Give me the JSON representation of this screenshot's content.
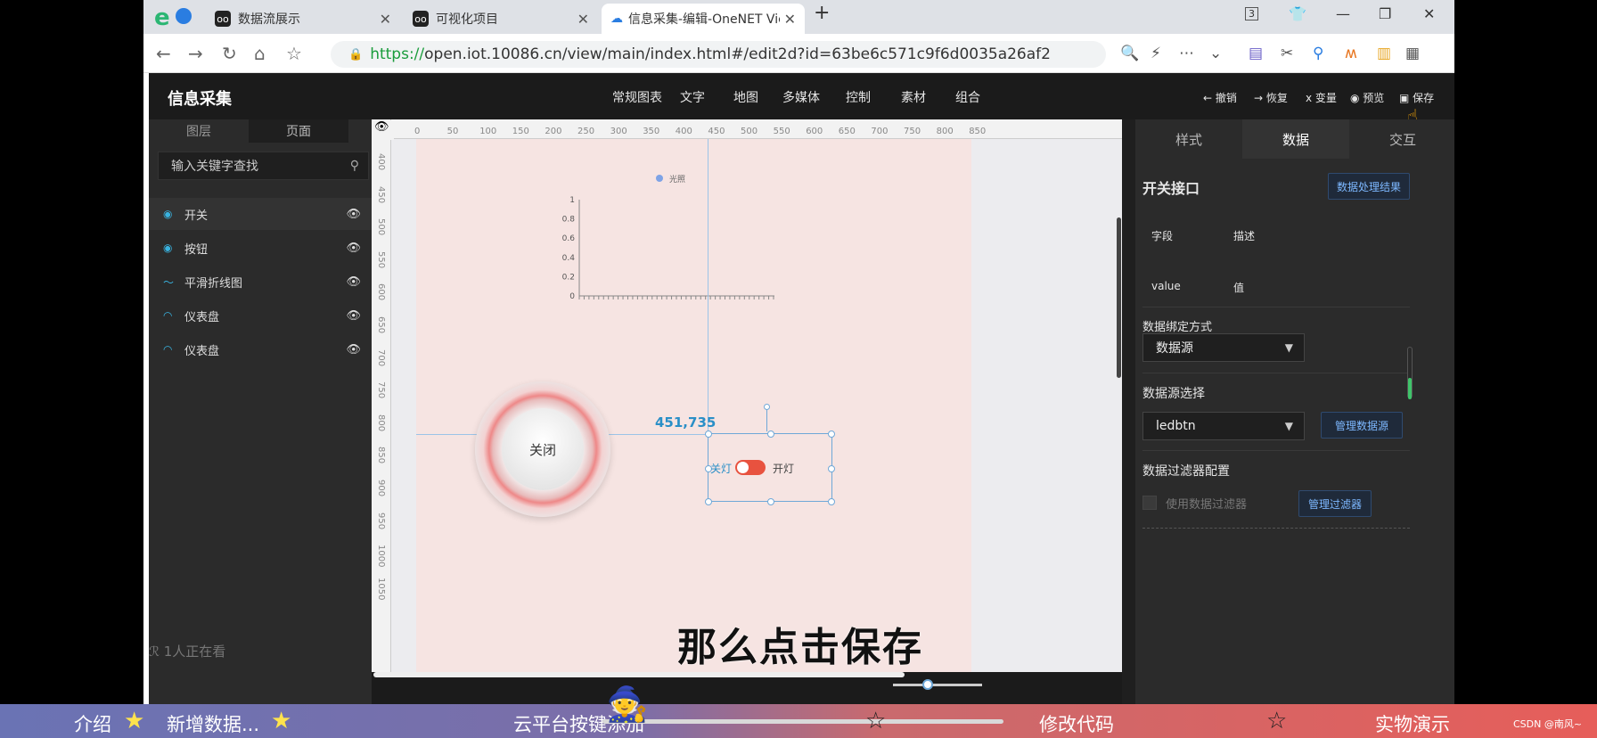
{
  "tabs": [
    {
      "label": "数据流展示"
    },
    {
      "label": "可视化项目"
    },
    {
      "label": "信息采集-编辑-OneNET View"
    }
  ],
  "address": {
    "scheme": "https://",
    "url": "open.iot.10086.cn/view/main/index.html#/edit2d?id=63be6c571c9f6d0035a26af2"
  },
  "header": {
    "title": "信息采集",
    "menu": [
      "常规图表",
      "文字",
      "地图",
      "多媒体",
      "控制",
      "素材",
      "组合"
    ],
    "actions": {
      "undo": "撤销",
      "redo": "恢复",
      "variable": "变量",
      "preview": "预览",
      "save": "保存"
    }
  },
  "left": {
    "tabs": [
      "图层",
      "页面"
    ],
    "search_placeholder": "输入关键字查找",
    "layers": [
      "开关",
      "按钮",
      "平滑折线图",
      "仪表盘",
      "仪表盘"
    ],
    "viewers": "1人正在看"
  },
  "canvas": {
    "hruler": [
      "0",
      "50",
      "100",
      "150",
      "200",
      "250",
      "300",
      "350",
      "400",
      "450",
      "500",
      "550",
      "600",
      "650",
      "700",
      "750",
      "800",
      "850"
    ],
    "vruler": [
      "400",
      "450",
      "500",
      "550",
      "600",
      "650",
      "700",
      "750",
      "800",
      "850",
      "900",
      "950",
      "1000",
      "1050"
    ],
    "coords": "451,735",
    "chart_legend": "光照",
    "chart_yticks": [
      "1",
      "0.8",
      "0.6",
      "0.4",
      "0.2",
      "0"
    ],
    "round_button_label": "关闭",
    "switch_off_label": "关灯",
    "switch_on_label": "开灯"
  },
  "chart_data": {
    "type": "line",
    "series": [
      {
        "name": "光照",
        "values": []
      }
    ],
    "ylim": [
      0,
      1
    ],
    "yticks": [
      0,
      0.2,
      0.4,
      0.6,
      0.8,
      1
    ]
  },
  "right": {
    "tabs": [
      "样式",
      "数据",
      "交互"
    ],
    "section_title": "开关接口",
    "process_button": "数据处理结果",
    "fields": {
      "field_h": "字段",
      "desc_h": "描述",
      "field": "value",
      "desc": "值"
    },
    "bind_label": "数据绑定方式",
    "bind_value": "数据源",
    "source_label": "数据源选择",
    "source_value": "ledbtn",
    "manage_source": "管理数据源",
    "filter_label": "数据过滤器配置",
    "filter_checkbox": "使用数据过滤器",
    "manage_filter": "管理过滤器"
  },
  "subtitle": "那么点击保存",
  "captions": [
    "介绍",
    "新增数据...",
    "云平台按键添加",
    "修改代码",
    "实物演示"
  ],
  "watermark": "CSDN @南风~",
  "colors": {
    "accent": "#e8523f",
    "link": "#7db8ff",
    "teal": "#39b3e0"
  }
}
